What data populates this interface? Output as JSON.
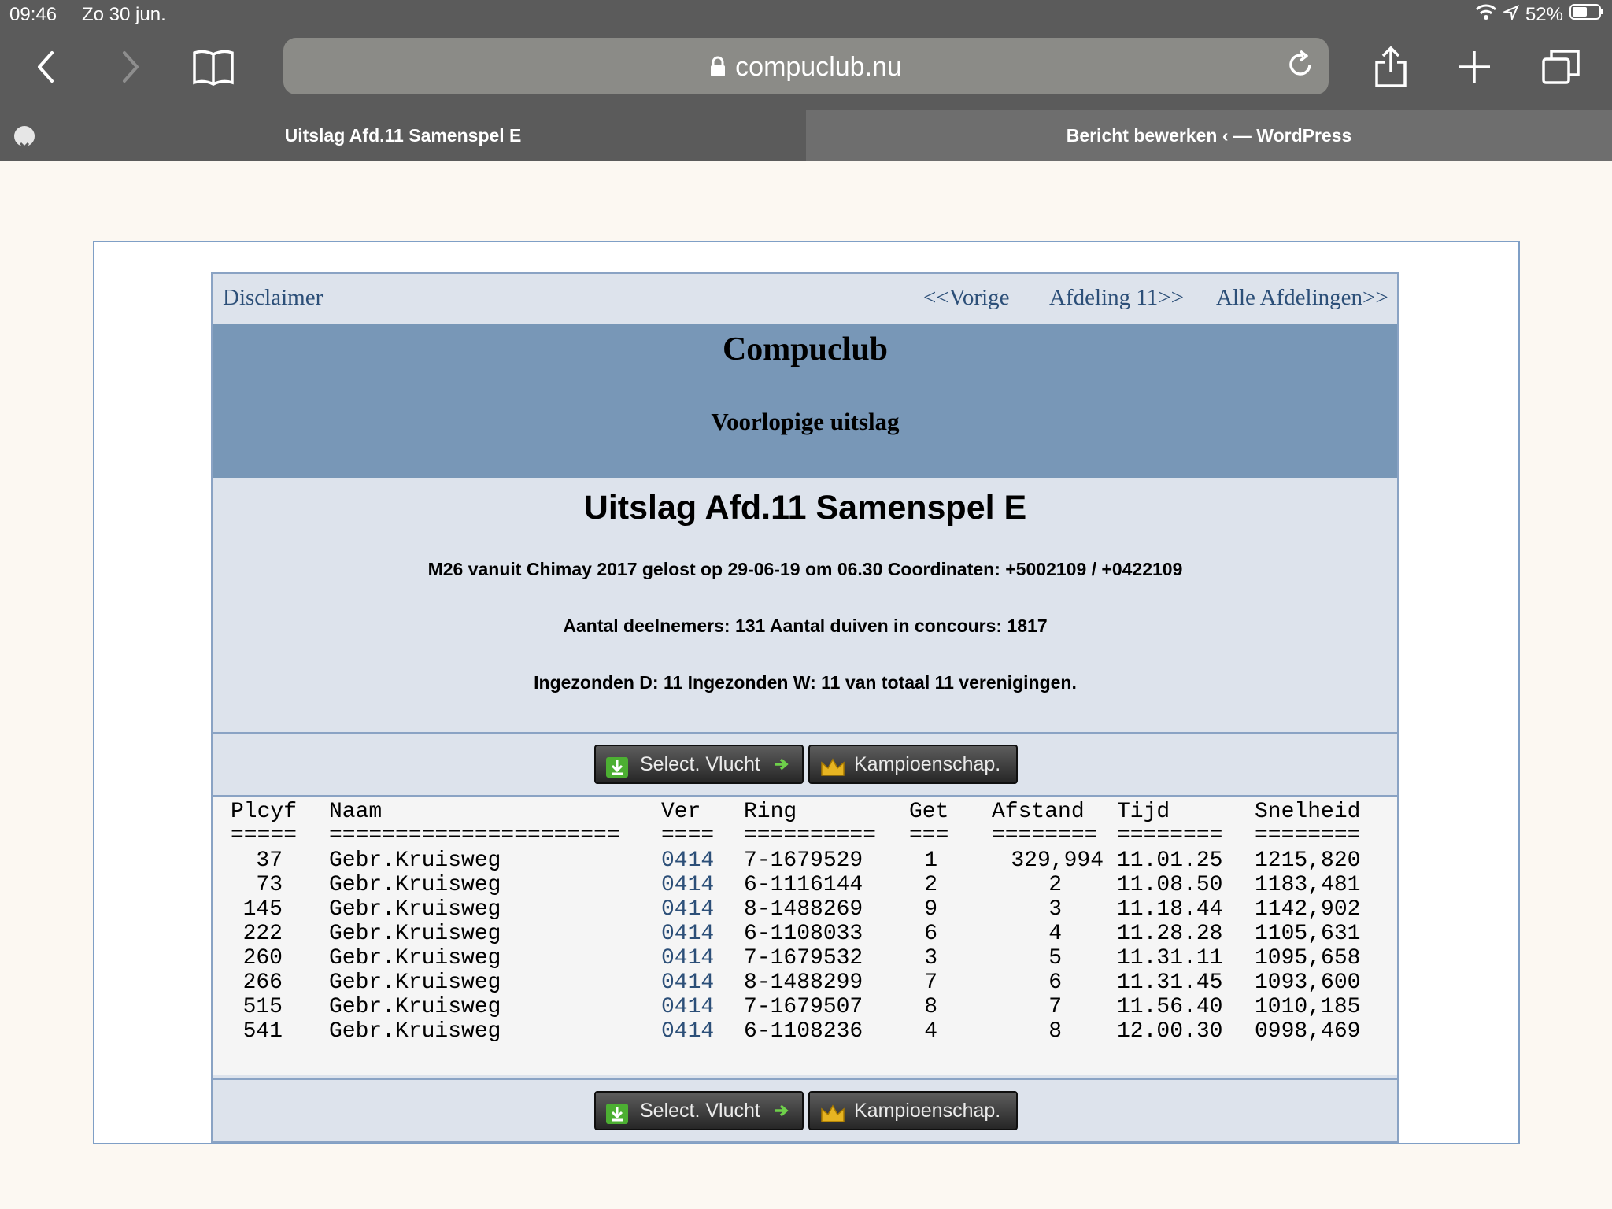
{
  "status": {
    "time": "09:46",
    "date": "Zo 30 jun.",
    "battery": "52%"
  },
  "browser": {
    "url": "compuclub.nu",
    "tabs": [
      {
        "label": "Uitslag Afd.11 Samenspel E"
      },
      {
        "label": "Bericht bewerken ‹ — WordPress"
      }
    ]
  },
  "nav": {
    "disclaimer": "Disclaimer",
    "prev": "<<Vorige",
    "afdeling": "Afdeling 11>>",
    "alle": "Alle Afdelingen>>"
  },
  "header": {
    "club": "Compuclub",
    "subtitle": "Voorlopige uitslag"
  },
  "info": {
    "title": "Uitslag Afd.11 Samenspel E",
    "flight": "M26 vanuit Chimay 2017 gelost op 29-06-19 om 06.30 Coordinaten: +5002109 / +0422109",
    "participants": "Aantal deelnemers: 131 Aantal duiven in concours: 1817",
    "submitted": "Ingezonden D: 11 Ingezonden W: 11 van totaal 11 verenigingen."
  },
  "buttons": {
    "select": "Select. Vlucht",
    "kampioen": "Kampioenschap."
  },
  "table": {
    "headers": {
      "plcyf": "Plcyf",
      "naam": "Naam",
      "ver": "Ver",
      "ring": "Ring",
      "get": "Get",
      "afstand": "Afstand",
      "tijd": "Tijd",
      "snelheid": "Snelheid"
    },
    "underlines": {
      "plcyf": "=====",
      "naam": "======================",
      "ver": "====",
      "ring": "==========",
      "get": "===",
      "afstand": "========",
      "tijd": "========",
      "snelheid": "========"
    },
    "rows": [
      {
        "plcyf": "37",
        "naam": "Gebr.Kruisweg",
        "ver": "0414",
        "ring": "7-1679529",
        "get": "1",
        "afstand": "329,994",
        "tijd": "11.01.25",
        "snelheid": "1215,820"
      },
      {
        "plcyf": "73",
        "naam": "Gebr.Kruisweg",
        "ver": "0414",
        "ring": "6-1116144",
        "get": "2",
        "afstand": "2",
        "tijd": "11.08.50",
        "snelheid": "1183,481"
      },
      {
        "plcyf": "145",
        "naam": "Gebr.Kruisweg",
        "ver": "0414",
        "ring": "8-1488269",
        "get": "9",
        "afstand": "3",
        "tijd": "11.18.44",
        "snelheid": "1142,902"
      },
      {
        "plcyf": "222",
        "naam": "Gebr.Kruisweg",
        "ver": "0414",
        "ring": "6-1108033",
        "get": "6",
        "afstand": "4",
        "tijd": "11.28.28",
        "snelheid": "1105,631"
      },
      {
        "plcyf": "260",
        "naam": "Gebr.Kruisweg",
        "ver": "0414",
        "ring": "7-1679532",
        "get": "3",
        "afstand": "5",
        "tijd": "11.31.11",
        "snelheid": "1095,658"
      },
      {
        "plcyf": "266",
        "naam": "Gebr.Kruisweg",
        "ver": "0414",
        "ring": "8-1488299",
        "get": "7",
        "afstand": "6",
        "tijd": "11.31.45",
        "snelheid": "1093,600"
      },
      {
        "plcyf": "515",
        "naam": "Gebr.Kruisweg",
        "ver": "0414",
        "ring": "7-1679507",
        "get": "8",
        "afstand": "7",
        "tijd": "11.56.40",
        "snelheid": "1010,185"
      },
      {
        "plcyf": "541",
        "naam": "Gebr.Kruisweg",
        "ver": "0414",
        "ring": "6-1108236",
        "get": "4",
        "afstand": "8",
        "tijd": "12.00.30",
        "snelheid": "0998,469"
      }
    ]
  }
}
